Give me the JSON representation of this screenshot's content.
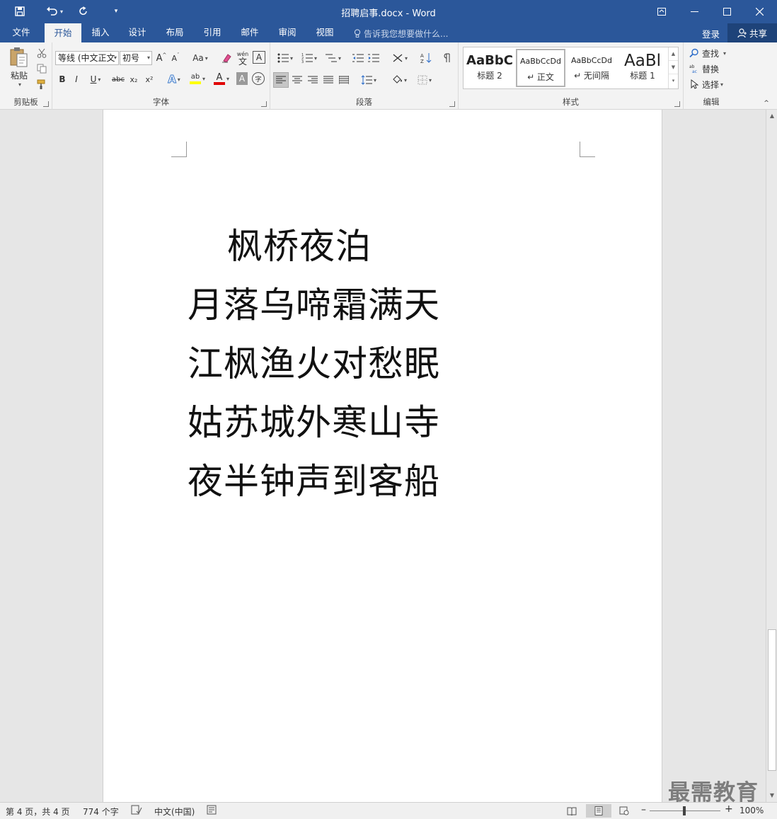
{
  "titlebar": {
    "title": "招聘启事.docx - Word"
  },
  "tabs": [
    {
      "label": "文件"
    },
    {
      "label": "开始"
    },
    {
      "label": "插入"
    },
    {
      "label": "设计"
    },
    {
      "label": "布局"
    },
    {
      "label": "引用"
    },
    {
      "label": "邮件"
    },
    {
      "label": "审阅"
    },
    {
      "label": "视图"
    }
  ],
  "tellme": {
    "placeholder": "告诉我您想要做什么..."
  },
  "account": {
    "login": "登录",
    "share": "共享"
  },
  "ribbon": {
    "clipboard": {
      "label": "剪贴板",
      "paste": "粘贴"
    },
    "font": {
      "label": "字体",
      "font_name": "等线 (中文正文",
      "font_size": "初号",
      "change_case": "Aa",
      "phonetic_top": "wén",
      "phonetic_bottom": "文",
      "border_char": "A",
      "bold": "B",
      "italic": "I",
      "underline": "U",
      "strike": "abc",
      "sub": "x₂",
      "sup": "x²",
      "effects": "A",
      "highlight": "ab",
      "font_color": "A",
      "char_shade": "A",
      "enclose": "字"
    },
    "paragraph": {
      "label": "段落"
    },
    "styles": {
      "label": "样式",
      "items": [
        {
          "sample": "AaBbC",
          "name": "标题 2"
        },
        {
          "sample": "AaBbCcDd",
          "name": "↵ 正文"
        },
        {
          "sample": "AaBbCcDd",
          "name": "↵ 无间隔"
        },
        {
          "sample": "AaBl",
          "name": "标题 1"
        }
      ]
    },
    "editing": {
      "label": "编辑",
      "find": "查找",
      "replace": "替换",
      "select": "选择"
    }
  },
  "document": {
    "lines": [
      "枫桥夜泊",
      "月落乌啼霜满天",
      "江枫渔火对愁眠",
      "姑苏城外寒山寺",
      "夜半钟声到客船"
    ]
  },
  "status": {
    "page": "第 4 页，共 4 页",
    "words": "774 个字",
    "language": "中文(中国)",
    "zoom": "100%"
  },
  "watermark": "最需教育",
  "colors": {
    "brand": "#2b579a",
    "ribbon_bg": "#f3f3f3",
    "doc_bg": "#e6e6e6"
  }
}
